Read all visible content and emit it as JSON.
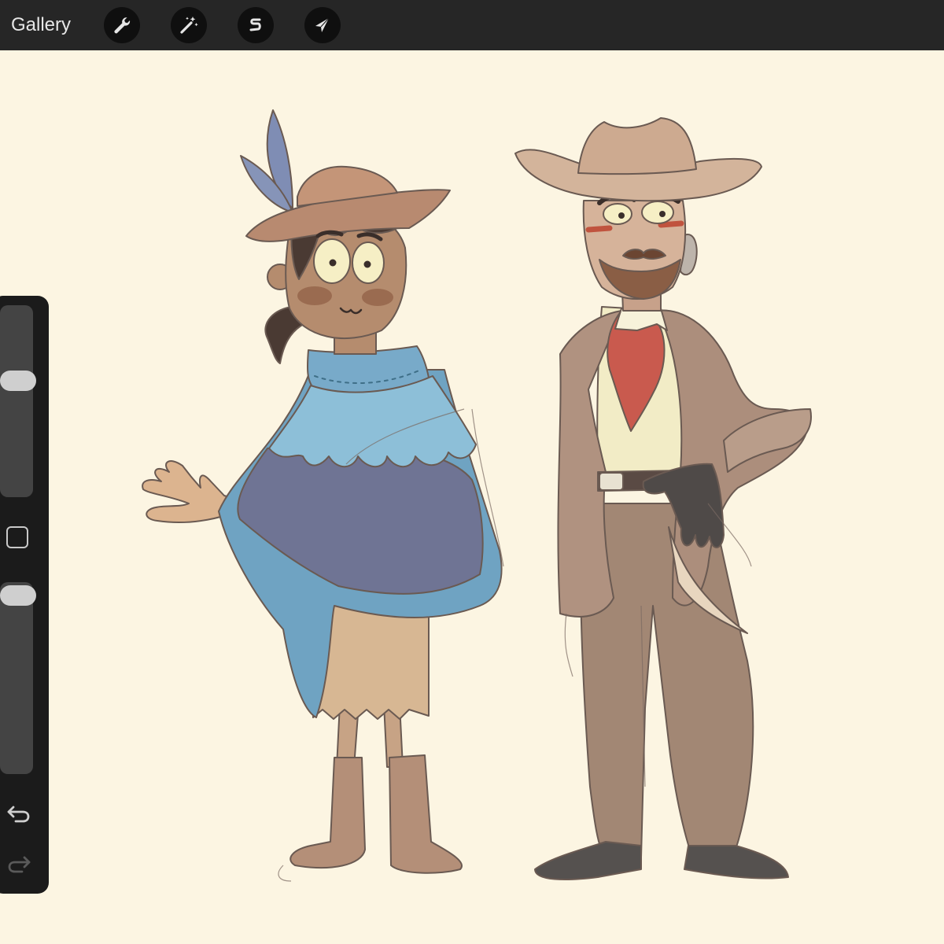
{
  "topbar": {
    "gallery_label": "Gallery",
    "tools": [
      {
        "name": "actions",
        "icon": "wrench-icon"
      },
      {
        "name": "adjustments",
        "icon": "magic-wand-icon"
      },
      {
        "name": "selection",
        "icon": "selection-s-icon"
      },
      {
        "name": "transform",
        "icon": "arrow-cursor-icon"
      }
    ]
  },
  "sidebar": {
    "brush_size": 0.62,
    "opacity": 0.98,
    "buttons": [
      {
        "name": "modify",
        "icon": "square-icon"
      },
      {
        "name": "undo",
        "icon": "undo-icon"
      },
      {
        "name": "redo",
        "icon": "redo-icon"
      }
    ]
  },
  "colors": {
    "topbar": "#262626",
    "canvas": "#fcf5e2",
    "poncho_light": "#6fa3c2",
    "poncho_dark": "#6f7494",
    "suit": "#a88a77",
    "hat": "#c9a990",
    "scarf": "#c95a4e"
  }
}
